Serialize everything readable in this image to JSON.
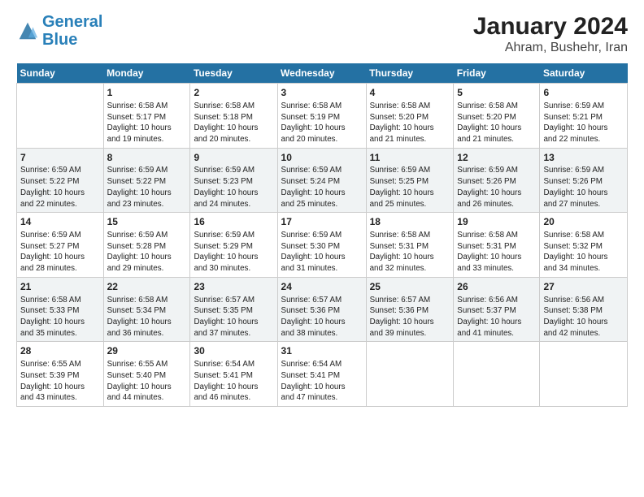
{
  "header": {
    "logo_line1": "General",
    "logo_line2": "Blue",
    "title": "January 2024",
    "subtitle": "Ahram, Bushehr, Iran"
  },
  "columns": [
    "Sunday",
    "Monday",
    "Tuesday",
    "Wednesday",
    "Thursday",
    "Friday",
    "Saturday"
  ],
  "weeks": [
    [
      {
        "day": "",
        "info": ""
      },
      {
        "day": "1",
        "info": "Sunrise: 6:58 AM\nSunset: 5:17 PM\nDaylight: 10 hours\nand 19 minutes."
      },
      {
        "day": "2",
        "info": "Sunrise: 6:58 AM\nSunset: 5:18 PM\nDaylight: 10 hours\nand 20 minutes."
      },
      {
        "day": "3",
        "info": "Sunrise: 6:58 AM\nSunset: 5:19 PM\nDaylight: 10 hours\nand 20 minutes."
      },
      {
        "day": "4",
        "info": "Sunrise: 6:58 AM\nSunset: 5:20 PM\nDaylight: 10 hours\nand 21 minutes."
      },
      {
        "day": "5",
        "info": "Sunrise: 6:58 AM\nSunset: 5:20 PM\nDaylight: 10 hours\nand 21 minutes."
      },
      {
        "day": "6",
        "info": "Sunrise: 6:59 AM\nSunset: 5:21 PM\nDaylight: 10 hours\nand 22 minutes."
      }
    ],
    [
      {
        "day": "7",
        "info": "Sunrise: 6:59 AM\nSunset: 5:22 PM\nDaylight: 10 hours\nand 22 minutes."
      },
      {
        "day": "8",
        "info": "Sunrise: 6:59 AM\nSunset: 5:22 PM\nDaylight: 10 hours\nand 23 minutes."
      },
      {
        "day": "9",
        "info": "Sunrise: 6:59 AM\nSunset: 5:23 PM\nDaylight: 10 hours\nand 24 minutes."
      },
      {
        "day": "10",
        "info": "Sunrise: 6:59 AM\nSunset: 5:24 PM\nDaylight: 10 hours\nand 25 minutes."
      },
      {
        "day": "11",
        "info": "Sunrise: 6:59 AM\nSunset: 5:25 PM\nDaylight: 10 hours\nand 25 minutes."
      },
      {
        "day": "12",
        "info": "Sunrise: 6:59 AM\nSunset: 5:26 PM\nDaylight: 10 hours\nand 26 minutes."
      },
      {
        "day": "13",
        "info": "Sunrise: 6:59 AM\nSunset: 5:26 PM\nDaylight: 10 hours\nand 27 minutes."
      }
    ],
    [
      {
        "day": "14",
        "info": "Sunrise: 6:59 AM\nSunset: 5:27 PM\nDaylight: 10 hours\nand 28 minutes."
      },
      {
        "day": "15",
        "info": "Sunrise: 6:59 AM\nSunset: 5:28 PM\nDaylight: 10 hours\nand 29 minutes."
      },
      {
        "day": "16",
        "info": "Sunrise: 6:59 AM\nSunset: 5:29 PM\nDaylight: 10 hours\nand 30 minutes."
      },
      {
        "day": "17",
        "info": "Sunrise: 6:59 AM\nSunset: 5:30 PM\nDaylight: 10 hours\nand 31 minutes."
      },
      {
        "day": "18",
        "info": "Sunrise: 6:58 AM\nSunset: 5:31 PM\nDaylight: 10 hours\nand 32 minutes."
      },
      {
        "day": "19",
        "info": "Sunrise: 6:58 AM\nSunset: 5:31 PM\nDaylight: 10 hours\nand 33 minutes."
      },
      {
        "day": "20",
        "info": "Sunrise: 6:58 AM\nSunset: 5:32 PM\nDaylight: 10 hours\nand 34 minutes."
      }
    ],
    [
      {
        "day": "21",
        "info": "Sunrise: 6:58 AM\nSunset: 5:33 PM\nDaylight: 10 hours\nand 35 minutes."
      },
      {
        "day": "22",
        "info": "Sunrise: 6:58 AM\nSunset: 5:34 PM\nDaylight: 10 hours\nand 36 minutes."
      },
      {
        "day": "23",
        "info": "Sunrise: 6:57 AM\nSunset: 5:35 PM\nDaylight: 10 hours\nand 37 minutes."
      },
      {
        "day": "24",
        "info": "Sunrise: 6:57 AM\nSunset: 5:36 PM\nDaylight: 10 hours\nand 38 minutes."
      },
      {
        "day": "25",
        "info": "Sunrise: 6:57 AM\nSunset: 5:36 PM\nDaylight: 10 hours\nand 39 minutes."
      },
      {
        "day": "26",
        "info": "Sunrise: 6:56 AM\nSunset: 5:37 PM\nDaylight: 10 hours\nand 41 minutes."
      },
      {
        "day": "27",
        "info": "Sunrise: 6:56 AM\nSunset: 5:38 PM\nDaylight: 10 hours\nand 42 minutes."
      }
    ],
    [
      {
        "day": "28",
        "info": "Sunrise: 6:55 AM\nSunset: 5:39 PM\nDaylight: 10 hours\nand 43 minutes."
      },
      {
        "day": "29",
        "info": "Sunrise: 6:55 AM\nSunset: 5:40 PM\nDaylight: 10 hours\nand 44 minutes."
      },
      {
        "day": "30",
        "info": "Sunrise: 6:54 AM\nSunset: 5:41 PM\nDaylight: 10 hours\nand 46 minutes."
      },
      {
        "day": "31",
        "info": "Sunrise: 6:54 AM\nSunset: 5:41 PM\nDaylight: 10 hours\nand 47 minutes."
      },
      {
        "day": "",
        "info": ""
      },
      {
        "day": "",
        "info": ""
      },
      {
        "day": "",
        "info": ""
      }
    ]
  ]
}
